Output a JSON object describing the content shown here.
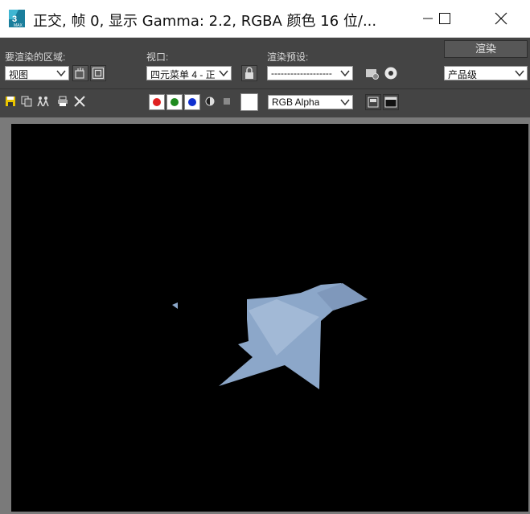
{
  "window": {
    "title": "正交, 帧 0, 显示 Gamma: 2.2, RGBA 颜色 16 位/...",
    "app_icon": "3ds-max-icon",
    "app_icon_text": "MAX"
  },
  "toolbar": {
    "area_label": "要渲染的区域:",
    "area_value": "视图",
    "viewport_label": "视口:",
    "viewport_value": "四元菜单 4 - 正",
    "preset_label": "渲染预设:",
    "preset_value": "-------------------",
    "render_button": "渲染",
    "quality_value": "产品级",
    "channel_value": "RGB Alpha"
  },
  "colors": {
    "red_channel": "#e02020",
    "green_channel": "#1e8a1e",
    "blue_channel": "#1030d0",
    "model": "#8ca7c9",
    "canvas_bg": "#000000"
  }
}
